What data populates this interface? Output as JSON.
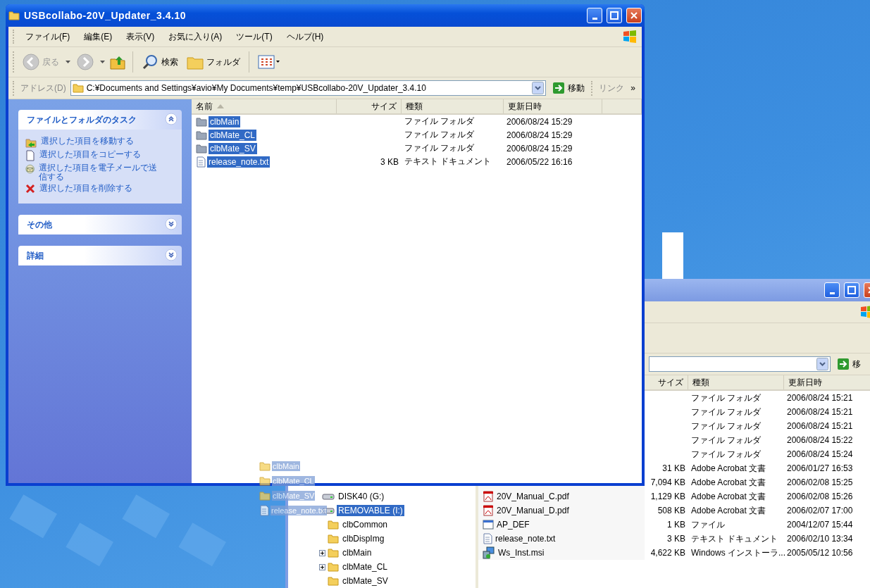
{
  "front_window": {
    "title": "USBcollabo-20V_Updater_3.4.10",
    "active": true,
    "menu": [
      "ファイル(F)",
      "編集(E)",
      "表示(V)",
      "お気に入り(A)",
      "ツール(T)",
      "ヘルプ(H)"
    ],
    "toolbar": {
      "back": {
        "label": "戻る",
        "disabled": true
      },
      "forward": {
        "disabled": true
      },
      "search": "検索",
      "folders": "フォルダ"
    },
    "address": {
      "label": "アドレス(D)",
      "value": "C:¥Documents and Settings¥avio¥My Documents¥temp¥USBcollabo-20V_Updater_3.4.10",
      "go": "移動",
      "links": "リンク",
      "more": "»"
    },
    "task_pane": [
      {
        "title": "ファイルとフォルダのタスク",
        "expanded": true,
        "items": [
          {
            "kind": "move",
            "label": "選択した項目を移動する"
          },
          {
            "kind": "copy",
            "label": "選択した項目をコピーする"
          },
          {
            "kind": "email",
            "label": "選択した項目を電子メールで送信する"
          },
          {
            "kind": "delete",
            "label": "選択した項目を削除する"
          }
        ]
      },
      {
        "title": "その他",
        "expanded": false
      },
      {
        "title": "詳細",
        "expanded": false
      }
    ],
    "columns": [
      {
        "label": "名前",
        "sorted": true
      },
      {
        "label": "サイズ",
        "sorted": false
      },
      {
        "label": "種類",
        "sorted": false
      },
      {
        "label": "更新日時",
        "sorted": false
      }
    ],
    "rows": [
      {
        "kind": "folder",
        "name": "clbMain",
        "type": "ファイル フォルダ",
        "date": "2006/08/24 15:29",
        "selected": true
      },
      {
        "kind": "folder",
        "name": "clbMate_CL",
        "type": "ファイル フォルダ",
        "date": "2006/08/24 15:29",
        "selected": true
      },
      {
        "kind": "folder",
        "name": "clbMate_SV",
        "type": "ファイル フォルダ",
        "date": "2006/08/24 15:29",
        "selected": true
      },
      {
        "kind": "txt",
        "name": "release_note.txt",
        "size": "3 KB",
        "type": "テキスト ドキュメント",
        "date": "2006/05/22 16:16",
        "selected": true
      }
    ]
  },
  "back_window": {
    "active": false,
    "go": "移",
    "columns": [
      {
        "label": "サイズ"
      },
      {
        "label": "種類"
      },
      {
        "label": "更新日時"
      }
    ],
    "tree": [
      {
        "kind": "drive",
        "label": "DISK40 (G:)",
        "selected": false
      },
      {
        "kind": "drive",
        "label": "REMOVABLE (I:)",
        "selected": true,
        "children": [
          {
            "kind": "folder",
            "label": "clbCommon",
            "selected": false,
            "has_children": false
          },
          {
            "kind": "folder",
            "label": "clbDispImg",
            "selected": false,
            "has_children": false
          },
          {
            "kind": "folder",
            "label": "clbMain",
            "selected": false,
            "has_children": true
          },
          {
            "kind": "folder",
            "label": "clbMate_CL",
            "selected": false,
            "has_children": true
          },
          {
            "kind": "folder",
            "label": "clbMate_SV",
            "selected": false,
            "has_children": false
          }
        ]
      }
    ],
    "rows": [
      {
        "type": "ファイル フォルダ",
        "date": "2006/08/24 15:21"
      },
      {
        "type": "ファイル フォルダ",
        "date": "2006/08/24 15:21"
      },
      {
        "type": "ファイル フォルダ",
        "date": "2006/08/24 15:21"
      },
      {
        "type": "ファイル フォルダ",
        "date": "2006/08/24 15:22"
      },
      {
        "type": "ファイル フォルダ",
        "date": "2006/08/24 15:24"
      },
      {
        "size": "31 KB",
        "type": "Adobe Acrobat 文書",
        "date": "2006/01/27 16:53"
      },
      {
        "size": "7,094 KB",
        "type": "Adobe Acrobat 文書",
        "date": "2006/02/08 15:25"
      },
      {
        "kind": "pdf",
        "name": "20V_Manual_C.pdf",
        "size": "1,129 KB",
        "type": "Adobe Acrobat 文書",
        "date": "2006/02/08 15:26"
      },
      {
        "kind": "pdf",
        "name": "20V_Manual_D.pdf",
        "size": "508 KB",
        "type": "Adobe Acrobat 文書",
        "date": "2006/02/07 17:00"
      },
      {
        "kind": "app",
        "name": "AP_DEF",
        "size": "1 KB",
        "type": "ファイル",
        "date": "2004/12/07 15:44"
      },
      {
        "kind": "txt",
        "name": "release_note.txt",
        "size": "3 KB",
        "type": "テキスト ドキュメント",
        "date": "2006/02/10 13:34"
      },
      {
        "kind": "msi",
        "name": "Ws_Inst.msi",
        "size": "4,622 KB",
        "type": "Windows インストーラ...",
        "date": "2005/05/12 10:56"
      }
    ]
  },
  "drag_ghost": {
    "items": [
      {
        "kind": "folder",
        "name": "clbMain"
      },
      {
        "kind": "folder",
        "name": "clbMate_CL"
      },
      {
        "kind": "folder",
        "name": "clbMate_SV"
      },
      {
        "kind": "txt",
        "name": "release_note.txt"
      }
    ]
  }
}
